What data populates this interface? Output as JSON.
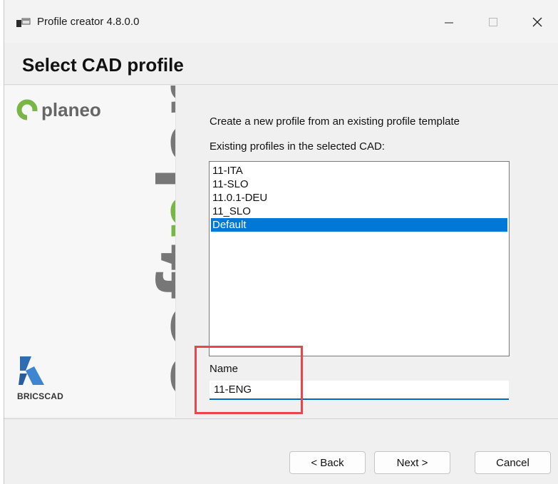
{
  "window": {
    "title": "Profile creator 4.8.0.0",
    "icons": [
      "app-icon",
      "minimize-icon",
      "maximize-icon",
      "close-icon"
    ]
  },
  "header": {
    "title": "Select CAD profile"
  },
  "branding": {
    "planeo": "planeo",
    "softplan_pre": "soft",
    "softplan_accent": "p",
    "softplan_post": "lan",
    "bricscad": "BRICSCAD",
    "accent_color": "#7ab547"
  },
  "content": {
    "description": "Create a new profile from an existing profile template",
    "profiles_label": "Existing profiles in the selected CAD:",
    "profiles": [
      "11-ITA",
      "11-SLO",
      "11.0.1-DEU",
      "11_SLO",
      "Default"
    ],
    "selected_profile": "Default",
    "name_label": "Name",
    "name_value": "11-ENG"
  },
  "buttons": {
    "back": "< Back",
    "next": "Next >",
    "cancel": "Cancel"
  },
  "colors": {
    "selection": "#0078d7",
    "highlight_box": "#e8464c"
  }
}
